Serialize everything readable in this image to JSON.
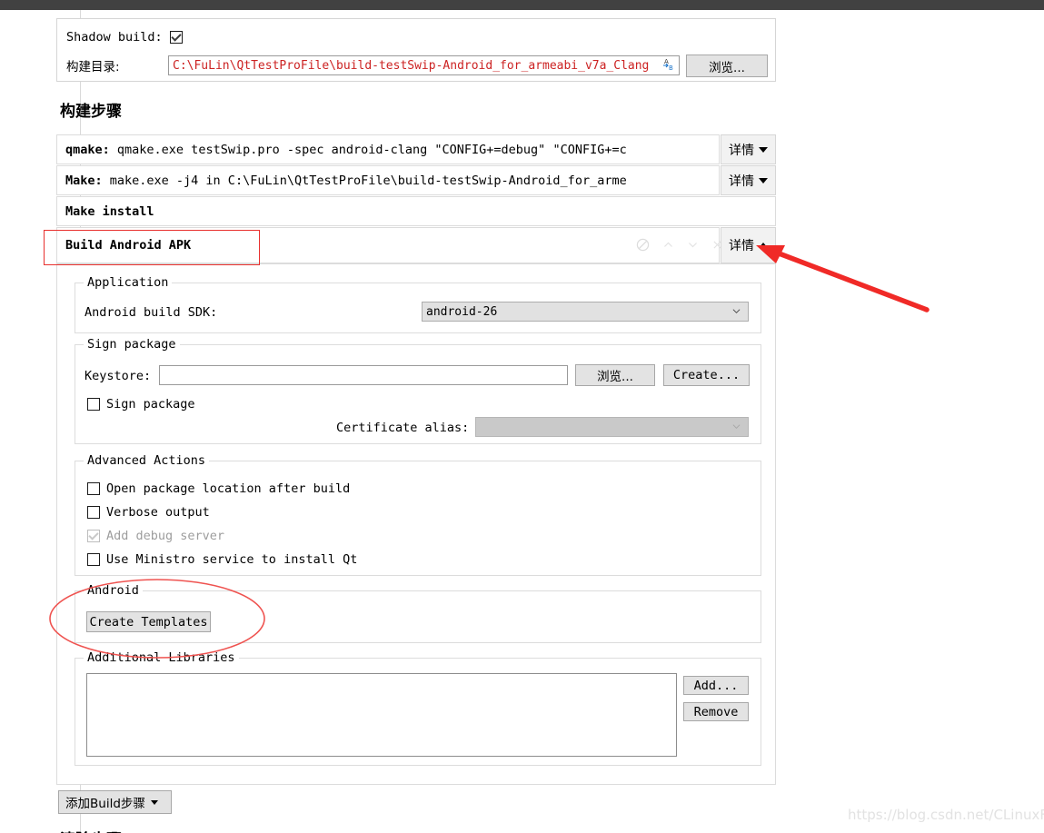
{
  "window": {
    "topbar_color": "#414141"
  },
  "general": {
    "shadow_build_label": "Shadow build:",
    "shadow_build_checked": true,
    "build_dir_label": "构建目录:",
    "build_dir_value": "C:\\FuLin\\QtTestProFile\\build-testSwip-Android_for_armeabi_v7a_Clang",
    "build_dir_color": "#cc2222",
    "browse_label": "浏览...",
    "var_icon_name": "variable-substitution-icon"
  },
  "build_steps": {
    "heading": "构建步骤",
    "detail_label": "详情",
    "steps": [
      {
        "name": "qmake",
        "prefix": "qmake:",
        "command": " qmake.exe testSwip.pro -spec android-clang \"CONFIG+=debug\" \"CONFIG+=c",
        "has_detail": true,
        "expanded": false
      },
      {
        "name": "make",
        "prefix": "Make:",
        "command": " make.exe -j4 in C:\\FuLin\\QtTestProFile\\build-testSwip-Android_for_arme",
        "has_detail": true,
        "expanded": false
      },
      {
        "name": "make-install",
        "prefix": "Make install",
        "command": "",
        "has_detail": false,
        "expanded": false
      },
      {
        "name": "build-android-apk",
        "prefix": "Build Android APK",
        "command": "",
        "has_detail": true,
        "expanded": true
      }
    ],
    "row_icons": [
      "disable-icon",
      "move-up-icon",
      "move-down-icon",
      "remove-icon"
    ]
  },
  "apk": {
    "application": {
      "group_title": "Application",
      "sdk_label": "Android build SDK:",
      "sdk_value": "android-26"
    },
    "sign_package": {
      "group_title": "Sign package",
      "keystore_label": "Keystore:",
      "keystore_value": "",
      "browse_label": "浏览...",
      "create_label": "Create...",
      "sign_checkbox_label": "Sign package",
      "sign_checkbox_checked": false,
      "cert_alias_label": "Certificate alias:",
      "cert_alias_value": ""
    },
    "advanced": {
      "group_title": "Advanced Actions",
      "options": [
        {
          "label": "Open package location after build",
          "checked": false,
          "disabled": false
        },
        {
          "label": "Verbose output",
          "checked": false,
          "disabled": false
        },
        {
          "label": "Add debug server",
          "checked": true,
          "disabled": true
        },
        {
          "label": "Use Ministro service to install Qt",
          "checked": false,
          "disabled": false
        }
      ]
    },
    "android": {
      "group_title": "Android",
      "create_templates_label": "Create Templates"
    },
    "libraries": {
      "group_title": "Additional Libraries",
      "items": [],
      "add_label": "Add...",
      "remove_label": "Remove"
    }
  },
  "footer": {
    "add_build_step_label": "添加Build步骤",
    "next_heading": "清除步骤"
  },
  "annotations": {
    "highlight_color": "#e8302e",
    "arrow_color": "#f02a27",
    "rect_target": "build-android-apk-step",
    "ellipse_target": "create-templates-button",
    "arrow_target": "detail-button-build-android-apk"
  },
  "watermark": {
    "text": "https://blog.csdn.net/CLinuxF"
  }
}
